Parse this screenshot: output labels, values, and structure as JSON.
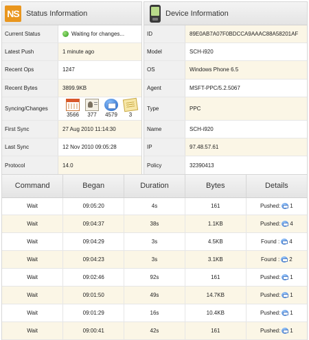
{
  "status": {
    "title": "Status Information",
    "logo": "NS",
    "rows": [
      {
        "label": "Current Status",
        "value": "Waiting for changes..."
      },
      {
        "label": "Latest Push",
        "value": "1 minute ago"
      },
      {
        "label": "Recent Ops",
        "value": "1247"
      },
      {
        "label": "Recent Bytes",
        "value": "3899.9KB"
      },
      {
        "label": "Syncing/Changes",
        "value": ""
      },
      {
        "label": "First Sync",
        "value": "27 Aug 2010 11:14:30"
      },
      {
        "label": "Last Sync",
        "value": "12 Nov 2010 09:05:28"
      },
      {
        "label": "Protocol",
        "value": "14.0"
      }
    ],
    "sync_counts": [
      {
        "icon": "calendar-icon",
        "count": "3566"
      },
      {
        "icon": "contacts-icon",
        "count": "377"
      },
      {
        "icon": "mail-icon",
        "count": "4579"
      },
      {
        "icon": "notes-icon",
        "count": "3"
      }
    ]
  },
  "device": {
    "title": "Device Information",
    "icon": "phone-icon",
    "rows": [
      {
        "label": "ID",
        "value": "89E0AB7A07F0BDCCA9AAAC88A58201AF"
      },
      {
        "label": "Model",
        "value": "SCH-i920"
      },
      {
        "label": "OS",
        "value": "Windows Phone 6.5"
      },
      {
        "label": "Agent",
        "value": "MSFT-PPC/5.2.5067"
      },
      {
        "label": "Type",
        "value": "PPC"
      },
      {
        "label": "Name",
        "value": "SCH-i920"
      },
      {
        "label": "IP",
        "value": "97.48.57.61"
      },
      {
        "label": "Policy",
        "value": "32390413"
      }
    ]
  },
  "commands": {
    "headers": [
      "Command",
      "Began",
      "Duration",
      "Bytes",
      "Details"
    ],
    "rows": [
      {
        "command": "Wait",
        "began": "09:05:20",
        "duration": "4s",
        "bytes": "161",
        "detail_label": "Pushed:",
        "detail_count": "1"
      },
      {
        "command": "Wait",
        "began": "09:04:37",
        "duration": "38s",
        "bytes": "1.1KB",
        "detail_label": "Pushed:",
        "detail_count": "4"
      },
      {
        "command": "Wait",
        "began": "09:04:29",
        "duration": "3s",
        "bytes": "4.5KB",
        "detail_label": "Found :",
        "detail_count": "4"
      },
      {
        "command": "Wait",
        "began": "09:04:23",
        "duration": "3s",
        "bytes": "3.1KB",
        "detail_label": "Found :",
        "detail_count": "2"
      },
      {
        "command": "Wait",
        "began": "09:02:46",
        "duration": "92s",
        "bytes": "161",
        "detail_label": "Pushed:",
        "detail_count": "1"
      },
      {
        "command": "Wait",
        "began": "09:01:50",
        "duration": "49s",
        "bytes": "14.7KB",
        "detail_label": "Pushed:",
        "detail_count": "1"
      },
      {
        "command": "Wait",
        "began": "09:01:29",
        "duration": "16s",
        "bytes": "10.4KB",
        "detail_label": "Pushed:",
        "detail_count": "1"
      },
      {
        "command": "Wait",
        "began": "09:00:41",
        "duration": "42s",
        "bytes": "161",
        "detail_label": "Pushed:",
        "detail_count": "1"
      }
    ]
  }
}
